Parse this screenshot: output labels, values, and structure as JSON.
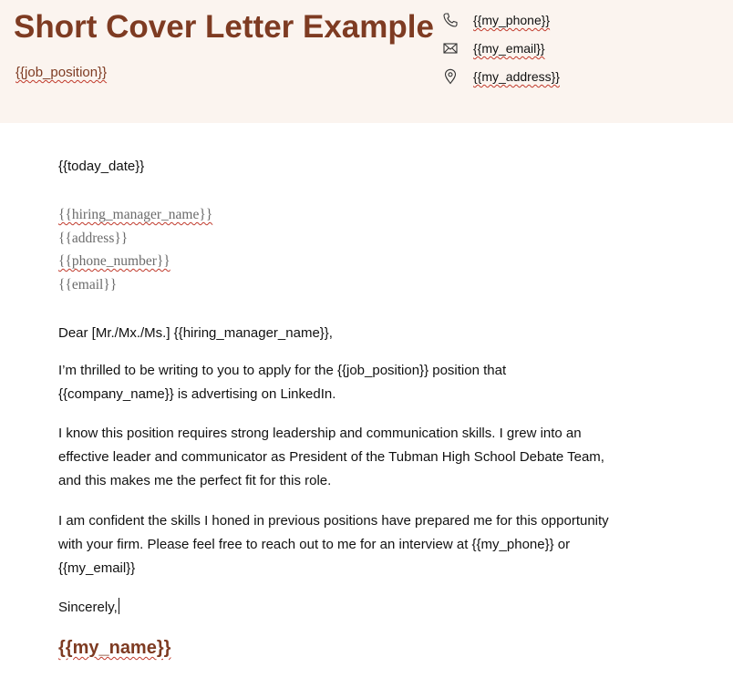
{
  "header": {
    "title": "Short Cover Letter Example",
    "job_position": "{{job_position}}",
    "contacts": {
      "phone": "{{my_phone}}",
      "email": "{{my_email}}",
      "address": "{{my_address}}"
    }
  },
  "letter": {
    "date": "{{today_date}}",
    "recipient": {
      "name": "{{hiring_manager_name}}",
      "address": "{{address}}",
      "phone": "{{phone_number}}",
      "email": "{{email}}"
    },
    "salutation": "Dear [Mr./Mx./Ms.] {{hiring_manager_name}},",
    "paragraph1": {
      "line1": "I’m thrilled to be writing to you to apply for the {{job_position}} position that",
      "line2": "{{company_name}} is advertising on LinkedIn."
    },
    "paragraph2": {
      "line1": "I know this position requires strong leadership and communication skills. I grew into an",
      "line2": "effective leader and communicator as President of the Tubman High School Debate Team,",
      "line3": "and this makes me the perfect fit for this role."
    },
    "paragraph3": {
      "line1": "I am confident the skills I honed in previous positions have prepared me for this opportunity",
      "line2": "with your firm. Please feel free to reach out to me for an interview at {{my_phone}} or",
      "line3": "{{my_email}}"
    },
    "closing": "Sincerely,",
    "signature": "{{my_name}}"
  },
  "colors": {
    "accent": "#7e3b22",
    "header_bg": "#fbf4ef",
    "muted_text": "#6b6b6b"
  }
}
